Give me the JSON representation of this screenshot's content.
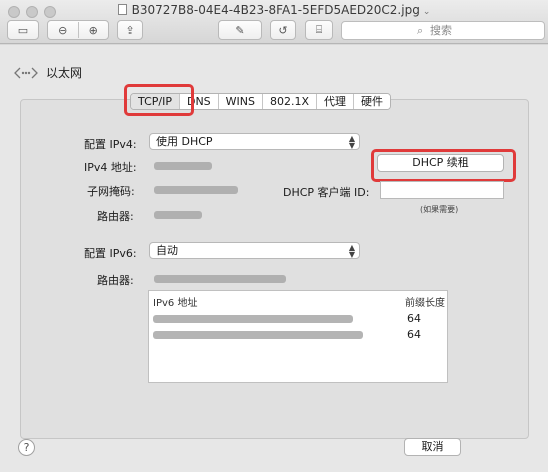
{
  "window": {
    "title": "B30727B8-04E4-4B23-8FA1-5EFD5AED20C2.jpg",
    "title_chevron": "⌄"
  },
  "toolbar": {
    "sidebar_icon": "▭",
    "zoom_out_icon": "⊖",
    "zoom_in_icon": "⊕",
    "share_icon": "⇪",
    "markup_icon": "✎",
    "rotate_icon": "↺",
    "toolbox_icon": "⌸",
    "search_placeholder": "搜索"
  },
  "header": {
    "title": "以太网"
  },
  "tabs": [
    {
      "label": "TCP/IP",
      "selected": true
    },
    {
      "label": "DNS",
      "selected": false
    },
    {
      "label": "WINS",
      "selected": false
    },
    {
      "label": "802.1X",
      "selected": false
    },
    {
      "label": "代理",
      "selected": false
    },
    {
      "label": "硬件",
      "selected": false
    }
  ],
  "ipv4": {
    "config_label": "配置 IPv4:",
    "config_value": "使用 DHCP",
    "address_label": "IPv4 地址:",
    "subnet_label": "子网掩码:",
    "router_label": "路由器:",
    "client_id_label": "DHCP 客户端 ID:",
    "client_id_value": "",
    "client_id_note": "(如果需要)",
    "renew_button": "DHCP 续租"
  },
  "ipv6": {
    "config_label": "配置 IPv6:",
    "config_value": "自动",
    "router_label": "路由器:",
    "table_headers": [
      "IPv6 地址",
      "前缀长度"
    ],
    "rows": [
      {
        "prefix": "64"
      },
      {
        "prefix": "64"
      }
    ]
  },
  "footer": {
    "help": "?",
    "cancel_button": "取消"
  },
  "colors": {
    "highlight": "#e03a3a"
  }
}
